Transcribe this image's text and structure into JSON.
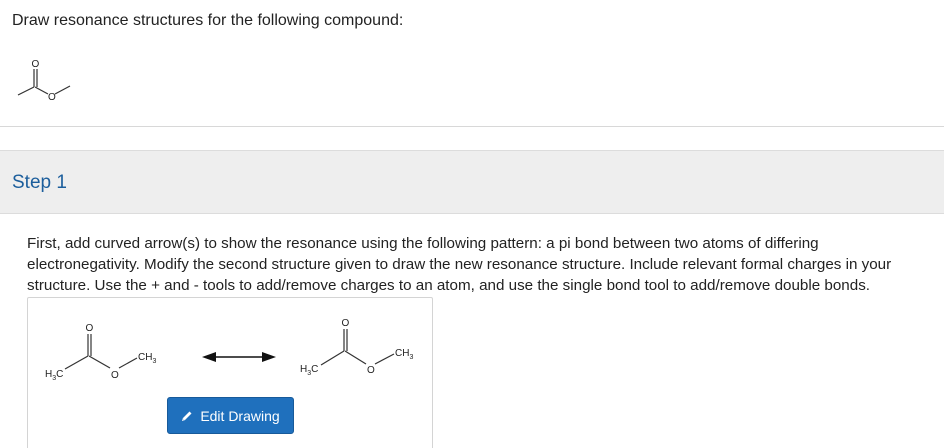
{
  "question": {
    "text": "Draw resonance structures for the following compound:",
    "structure_atoms": [
      "O",
      "O"
    ]
  },
  "step": {
    "title": "Step 1",
    "instructions": "First, add curved arrow(s) to show the resonance using the following pattern: a pi bond between two atoms of differing electronegativity. Modify the second structure given to draw the new resonance structure. Include relevant formal charges in your structure. Use the + and - tools to add/remove charges to an atom, and use the single bond tool to add/remove double bonds."
  },
  "drawing": {
    "left_structure": {
      "carbonyl_o": "O",
      "ester_o": "O",
      "methyl_left": {
        "main": "H",
        "sub": "3",
        "tail": "C"
      },
      "methyl_right": {
        "main": "CH",
        "sub": "3"
      }
    },
    "right_structure": {
      "carbonyl_o": "O",
      "ester_o": "O",
      "methyl_left": {
        "main": "H",
        "sub": "3",
        "tail": "C"
      },
      "methyl_right": {
        "main": "CH",
        "sub": "3"
      }
    },
    "edit_button_label": "Edit Drawing",
    "edit_button_icon": "pencil-icon"
  },
  "colors": {
    "step_title": "#1c5e9c",
    "button_bg": "#1f70bd",
    "step_header_bg": "#eeeeee"
  }
}
